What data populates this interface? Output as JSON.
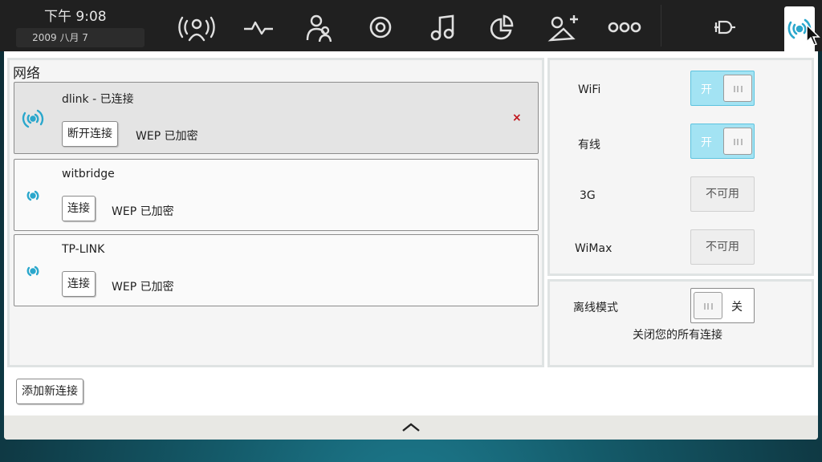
{
  "status_bar": {
    "time": "下午  9:08",
    "date": "2009 八月 7",
    "icons": [
      "broadcast-person-icon",
      "pulse-icon",
      "users-icon",
      "target-icon",
      "music-icon",
      "pie-chart-icon",
      "add-person-icon",
      "three-dots-icon",
      "connector-icon",
      "wifi-icon"
    ]
  },
  "network_panel": {
    "title": "网络",
    "networks": [
      {
        "name": "dlink - 已连接",
        "action": "断开连接",
        "security": "WEP 已加密",
        "remove": "×"
      },
      {
        "name": "witbridge",
        "action": "连接",
        "security": "WEP 已加密"
      },
      {
        "name": "TP-LINK",
        "action": "连接",
        "security": "WEP 已加密"
      }
    ],
    "add_button": "添加新连接"
  },
  "settings": {
    "wifi": {
      "label": "WiFi",
      "state": "开"
    },
    "wired": {
      "label": "有线",
      "state": "开"
    },
    "g3": {
      "label": "3G",
      "state": "不可用"
    },
    "wimax": {
      "label": "WiMax",
      "state": "不可用"
    },
    "offline": {
      "label": "离线模式",
      "state": "关",
      "desc": "关闭您的所有连接"
    }
  },
  "colors": {
    "accent": "#2aa7cc",
    "toggle_on": "#a3e3f3",
    "remove": "#c0141b"
  }
}
